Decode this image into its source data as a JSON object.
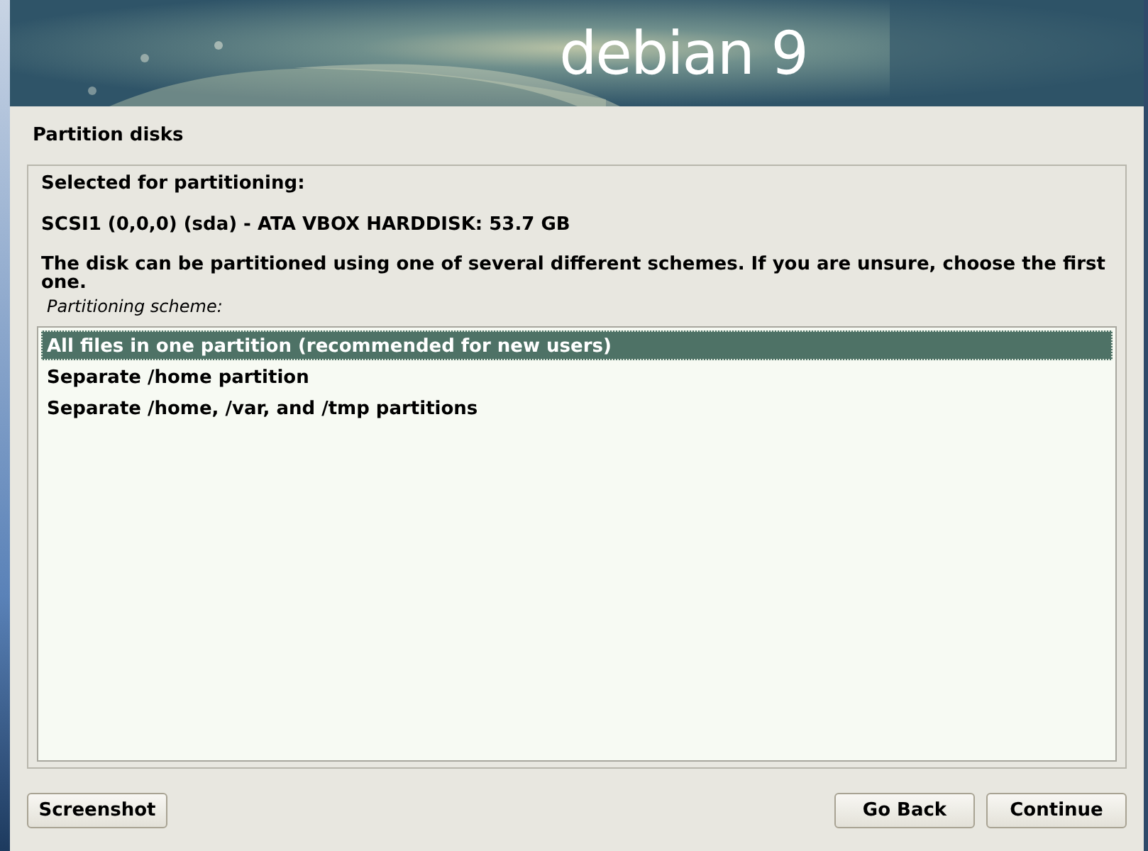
{
  "banner": {
    "logo": "debian 9"
  },
  "title": "Partition disks",
  "selected_label": "Selected for partitioning:",
  "disk": "SCSI1 (0,0,0) (sda) - ATA VBOX HARDDISK: 53.7 GB",
  "description": "The disk can be partitioned using one of several different schemes. If you are unsure, choose the first one.",
  "list_label": "Partitioning scheme:",
  "options": [
    {
      "label": "All files in one partition (recommended for new users)",
      "selected": true
    },
    {
      "label": "Separate /home partition",
      "selected": false
    },
    {
      "label": "Separate /home, /var, and /tmp partitions",
      "selected": false
    }
  ],
  "buttons": {
    "left": [
      "Screenshot"
    ],
    "right": [
      "Go Back",
      "Continue"
    ]
  }
}
